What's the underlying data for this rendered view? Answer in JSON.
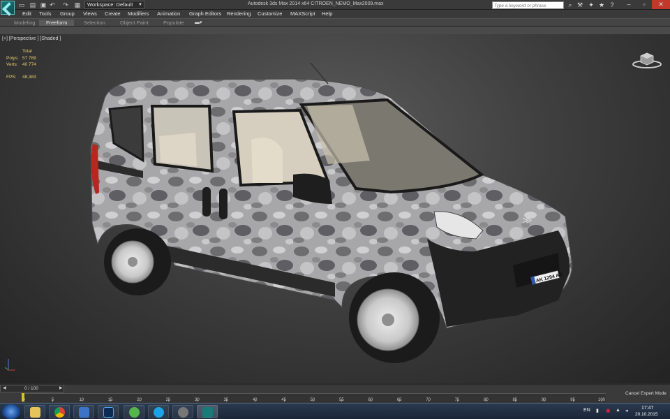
{
  "titlebar": {
    "workspace_label": "Workspace: Default",
    "title": "Autodesk 3ds Max  2014 x64    CITROEN_NEMO_Max2009.max",
    "search_placeholder": "Type a keyword or phrase"
  },
  "menu": [
    "Edit",
    "Tools",
    "Group",
    "Views",
    "Create",
    "Modifiers",
    "Animation",
    "Graph Editors",
    "Rendering",
    "Customize",
    "MAXScript",
    "Help"
  ],
  "ribbon": {
    "tabs": [
      "Modeling",
      "Freeform",
      "Selection",
      "Object Paint",
      "Populate"
    ],
    "active_tab": "Freeform"
  },
  "viewport": {
    "label": "[+] [Perspective ] [Shaded ]",
    "stats": {
      "header": "Total",
      "polys_label": "Polys:",
      "polys_value": "57 789",
      "verts_label": "Verts:",
      "verts_value": "40 774",
      "fps_label": "FPS:",
      "fps_value": "48,383"
    },
    "license_plate": "AK 1294 AB"
  },
  "timeline": {
    "slider_value": "0 / 100",
    "ticks": [
      "0",
      "5",
      "10",
      "15",
      "20",
      "25",
      "30",
      "35",
      "40",
      "45",
      "50",
      "55",
      "60",
      "65",
      "70",
      "75",
      "80",
      "85",
      "90",
      "95",
      "100"
    ],
    "status": "Cancel Expert Mode"
  },
  "taskbar": {
    "language": "EN",
    "time": "17:47",
    "date": "20.10.2015"
  }
}
